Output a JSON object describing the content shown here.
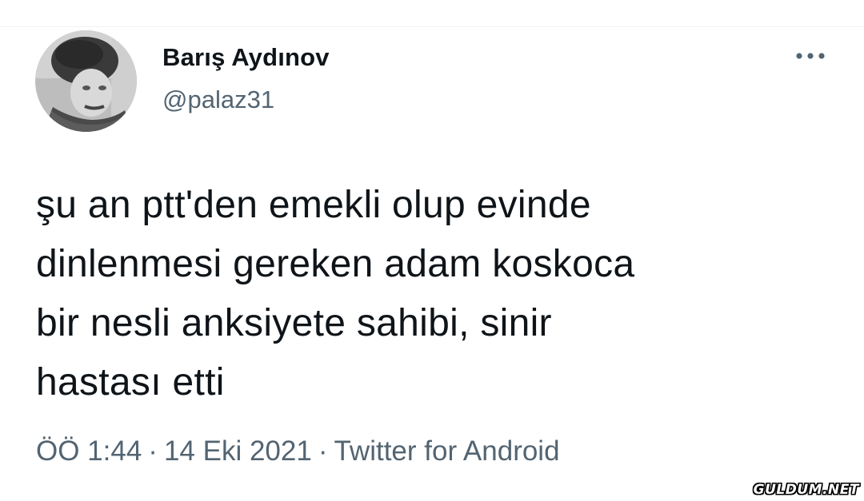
{
  "author": {
    "name": "Barış Aydınov",
    "handle": "@palaz31",
    "avatar_icon": "user-avatar-photo"
  },
  "more_icon": "more-horizontal-icon",
  "tweet": {
    "text": "şu an ptt'den emekli olup evinde\ndinlenmesi gereken adam koskoca\nbir nesli anksiyete sahibi, sinir\nhastası etti"
  },
  "meta": {
    "time": "ÖÖ 1:44",
    "separator": "·",
    "date": "14 Eki 2021",
    "source": "Twitter for Android"
  },
  "watermark": "GULDUM.NET",
  "colors": {
    "text_primary": "#0f1419",
    "text_secondary": "#536471",
    "background": "#ffffff"
  }
}
